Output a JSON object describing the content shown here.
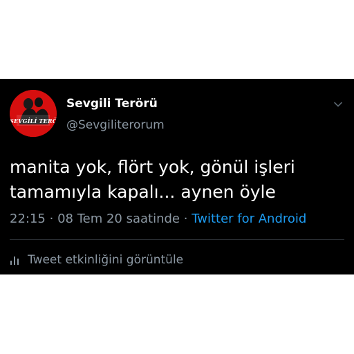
{
  "tweet": {
    "author": {
      "display_name": "Sevgili Terörü",
      "handle": "@Sevgiliterorum",
      "avatar_text": "SEVGİLİ TERÖRÜ"
    },
    "text_line1": "manita yok, flört yok, gönül işleri",
    "text_line2": "tamamıyla kapalı... aynen öyle",
    "time": "22:15",
    "date": "08 Tem 20 saatinde",
    "separator": "·",
    "source": "Twitter for Android",
    "activity_label": "Tweet etkinliğini görüntüle"
  },
  "colors": {
    "background": "#000000",
    "text_primary": "#ffffff",
    "text_secondary": "#8b97a2",
    "accent": "#1d9bf0",
    "avatar_red": "#d60f0f"
  },
  "icons": {
    "caret": "chevron-down-icon",
    "activity": "bar-chart-icon"
  }
}
